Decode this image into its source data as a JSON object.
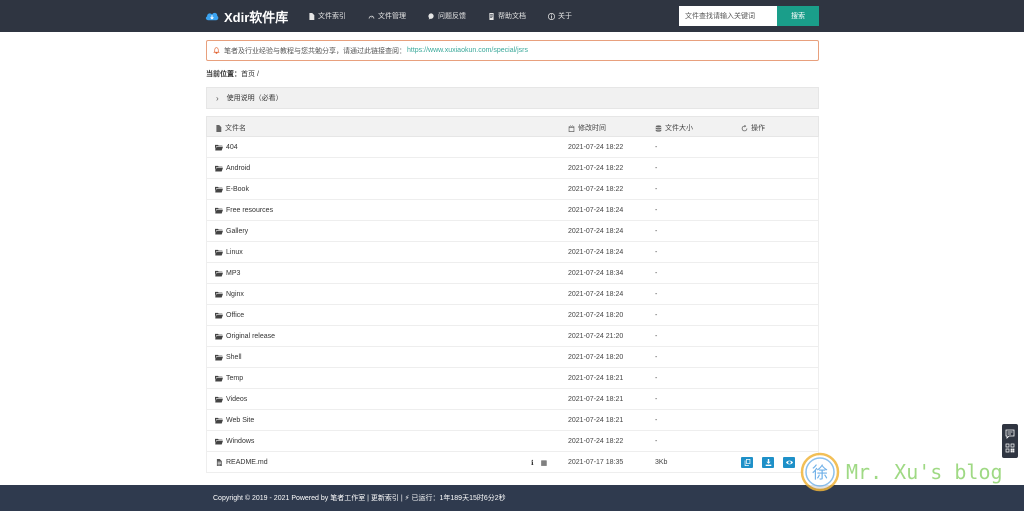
{
  "header": {
    "brand": "Xdir软件库",
    "nav": [
      {
        "label": "文件索引",
        "icon": "file-icon"
      },
      {
        "label": "文件管理",
        "icon": "dashboard-icon"
      },
      {
        "label": "问题反馈",
        "icon": "comment-icon"
      },
      {
        "label": "帮助文档",
        "icon": "doc-icon"
      },
      {
        "label": "关于",
        "icon": "info-icon"
      }
    ],
    "search_placeholder": "文件查找请输入关键词",
    "search_button": "搜索"
  },
  "notice": {
    "text": "笔者及行业经验与教程与您共勉分享，请通过此链接查阅：",
    "link": "https://www.xuxiaokun.com/special/jsrs"
  },
  "breadcrumb": {
    "label": "当前位置：",
    "path": "首页 /"
  },
  "instructions": {
    "label": "使用说明（必看）"
  },
  "table": {
    "headers": {
      "name": "文件名",
      "modified": "修改时间",
      "size": "文件大小",
      "actions": "操作"
    },
    "folders": [
      {
        "name": "404",
        "time": "2021-07-24 18:22",
        "size": "-"
      },
      {
        "name": "Android",
        "time": "2021-07-24 18:22",
        "size": "-"
      },
      {
        "name": "E-Book",
        "time": "2021-07-24 18:22",
        "size": "-"
      },
      {
        "name": "Free resources",
        "time": "2021-07-24 18:24",
        "size": "-"
      },
      {
        "name": "Gallery",
        "time": "2021-07-24 18:24",
        "size": "-"
      },
      {
        "name": "Linux",
        "time": "2021-07-24 18:24",
        "size": "-"
      },
      {
        "name": "MP3",
        "time": "2021-07-24 18:34",
        "size": "-"
      },
      {
        "name": "Nginx",
        "time": "2021-07-24 18:24",
        "size": "-"
      },
      {
        "name": "Office",
        "time": "2021-07-24 18:20",
        "size": "-"
      },
      {
        "name": "Original release",
        "time": "2021-07-24 21:20",
        "size": "-"
      },
      {
        "name": "Shell",
        "time": "2021-07-24 18:20",
        "size": "-"
      },
      {
        "name": "Temp",
        "time": "2021-07-24 18:21",
        "size": "-"
      },
      {
        "name": "Videos",
        "time": "2021-07-24 18:21",
        "size": "-"
      },
      {
        "name": "Web Site",
        "time": "2021-07-24 18:21",
        "size": "-"
      },
      {
        "name": "Windows",
        "time": "2021-07-24 18:22",
        "size": "-"
      }
    ],
    "file": {
      "name": "README.md",
      "info_glyph": "ℹ",
      "qr_glyph": "▦",
      "time": "2021-07-17 18:35",
      "size": "3Kb"
    }
  },
  "footer": {
    "text": "Copyright © 2019 - 2021 Powered by 笔者工作室 | 更新索引 | ⚡ 已运行：1年189天15时6分2秒"
  },
  "watermark": {
    "glyph": "徐",
    "text": "Mr. Xu's blog"
  },
  "colors": {
    "topbar": "#2f3541",
    "accent": "#1a9e8a",
    "action_button": "#1e90c8",
    "notice_border": "#e8a07d",
    "footer": "#2f3a4e"
  }
}
